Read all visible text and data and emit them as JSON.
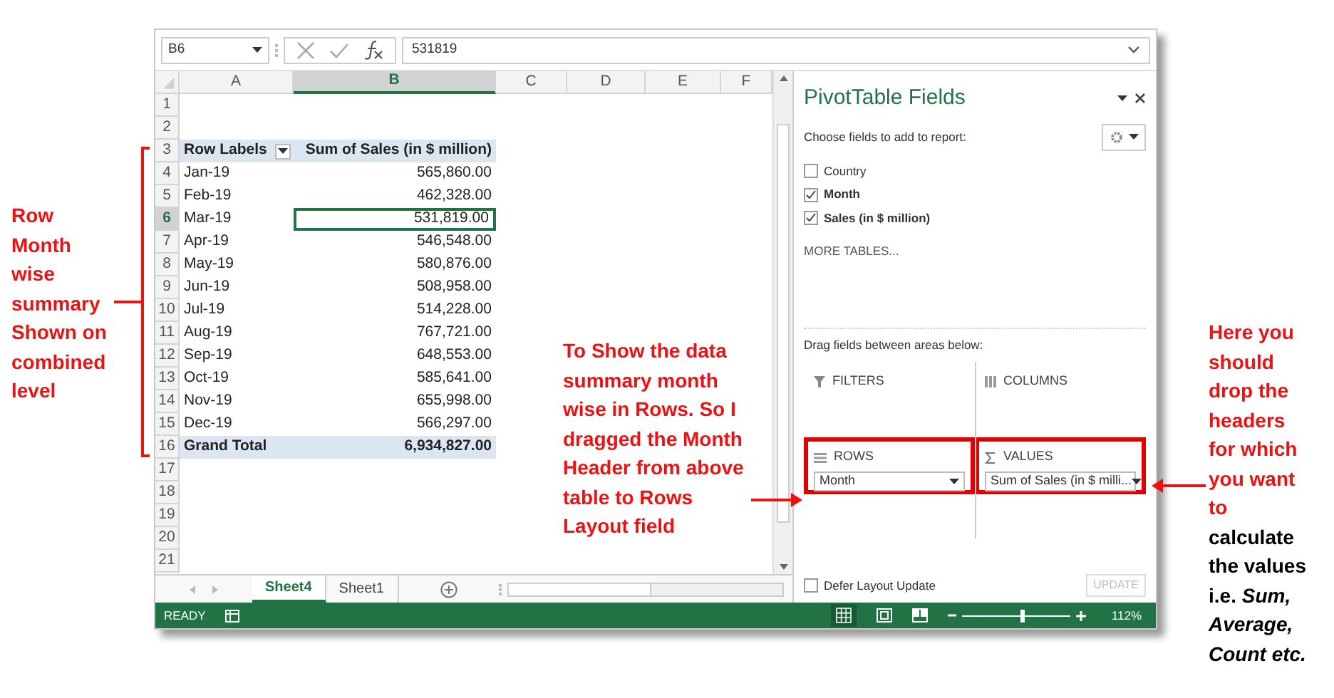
{
  "annotations": {
    "left": "Row Month wise summary Shown on combined level",
    "middle": "To Show the data summary month wise in Rows. So I dragged the Month Header from above table to Rows Layout field",
    "right_highlight": "Here you should drop the headers for which you want to",
    "right_rest": "calculate the values i.e. *Sum, Average, Count etc.*"
  },
  "formula_bar": {
    "name_box": "B6",
    "value": "531819"
  },
  "columns": [
    {
      "label": "A",
      "selected": false
    },
    {
      "label": "B",
      "selected": true
    },
    {
      "label": "C",
      "selected": false
    },
    {
      "label": "D",
      "selected": false
    },
    {
      "label": "E",
      "selected": false
    },
    {
      "label": "F",
      "selected": false
    }
  ],
  "rows": [
    {
      "number": "1",
      "kind": "empty",
      "selected": false
    },
    {
      "number": "2",
      "kind": "empty",
      "selected": false
    },
    {
      "number": "3",
      "kind": "header",
      "selected": false,
      "a": "Row Labels",
      "b": "Sum of Sales (in $ million)"
    },
    {
      "number": "4",
      "kind": "item",
      "selected": false,
      "a": "Jan-19",
      "b": "565,860.00"
    },
    {
      "number": "5",
      "kind": "item",
      "selected": false,
      "a": "Feb-19",
      "b": "462,328.00"
    },
    {
      "number": "6",
      "kind": "item",
      "selected": true,
      "a": "Mar-19",
      "b": "531,819.00"
    },
    {
      "number": "7",
      "kind": "item",
      "selected": false,
      "a": "Apr-19",
      "b": "546,548.00"
    },
    {
      "number": "8",
      "kind": "item",
      "selected": false,
      "a": "May-19",
      "b": "580,876.00"
    },
    {
      "number": "9",
      "kind": "item",
      "selected": false,
      "a": "Jun-19",
      "b": "508,958.00"
    },
    {
      "number": "10",
      "kind": "item",
      "selected": false,
      "a": "Jul-19",
      "b": "514,228.00"
    },
    {
      "number": "11",
      "kind": "item",
      "selected": false,
      "a": "Aug-19",
      "b": "767,721.00"
    },
    {
      "number": "12",
      "kind": "item",
      "selected": false,
      "a": "Sep-19",
      "b": "648,553.00"
    },
    {
      "number": "13",
      "kind": "item",
      "selected": false,
      "a": "Oct-19",
      "b": "585,641.00"
    },
    {
      "number": "14",
      "kind": "item",
      "selected": false,
      "a": "Nov-19",
      "b": "655,998.00"
    },
    {
      "number": "15",
      "kind": "item",
      "selected": false,
      "a": "Dec-19",
      "b": "566,297.00"
    },
    {
      "number": "16",
      "kind": "total",
      "selected": false,
      "a": "Grand Total",
      "b": "6,934,827.00"
    },
    {
      "number": "17",
      "kind": "empty",
      "selected": false
    },
    {
      "number": "18",
      "kind": "empty",
      "selected": false
    },
    {
      "number": "19",
      "kind": "empty",
      "selected": false
    },
    {
      "number": "20",
      "kind": "empty",
      "selected": false
    },
    {
      "number": "21",
      "kind": "empty",
      "selected": false
    }
  ],
  "sheet_tabs": [
    {
      "label": "Sheet4",
      "selected": true
    },
    {
      "label": "Sheet1",
      "selected": false
    }
  ],
  "pivot_pane": {
    "title": "PivotTable Fields",
    "subtitle": "Choose fields to add to report:",
    "fields": [
      {
        "label": "Country",
        "checked": false
      },
      {
        "label": "Month",
        "checked": true
      },
      {
        "label": "Sales (in $ million)",
        "checked": true
      }
    ],
    "more_tables": "MORE TABLES...",
    "drag_hint": "Drag fields between areas below:",
    "areas": [
      {
        "kind": "filters",
        "label": "FILTERS",
        "highlighted": false
      },
      {
        "kind": "columns",
        "label": "COLUMNS",
        "highlighted": false
      },
      {
        "kind": "rows",
        "label": "ROWS",
        "item": "Month",
        "highlighted": true
      },
      {
        "kind": "values",
        "label": "VALUES",
        "item": "Sum of Sales (in $ milli...",
        "highlighted": true
      }
    ],
    "defer": {
      "label": "Defer Layout Update",
      "checked": false
    },
    "update_button": {
      "label": "UPDATE",
      "disabled": true
    }
  },
  "status_bar": {
    "mode": "READY",
    "zoom": "112%",
    "zoom_slider": {
      "level": 0.56
    }
  }
}
